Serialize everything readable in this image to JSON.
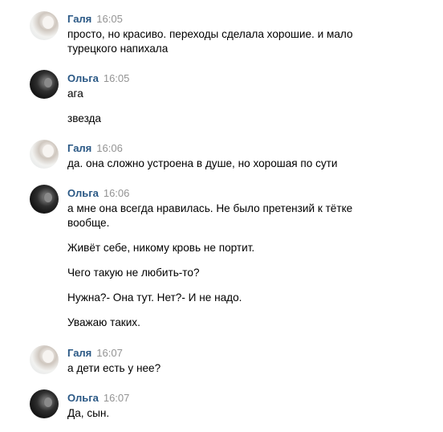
{
  "messages": [
    {
      "author": "Галя",
      "time": "16:05",
      "avatar_icon": "user-avatar-galya",
      "lines": [
        "просто, но красиво. переходы сделала хорошие. и мало",
        "турецкого напихала"
      ]
    },
    {
      "author": "Ольга",
      "time": "16:05",
      "avatar_icon": "user-avatar-olga",
      "lines": [
        "ага",
        "звезда"
      ]
    },
    {
      "author": "Галя",
      "time": "16:06",
      "avatar_icon": "user-avatar-galya",
      "lines": [
        "да. она сложно устроена в душе, но хорошая по сути"
      ]
    },
    {
      "author": "Ольга",
      "time": "16:06",
      "avatar_icon": "user-avatar-olga",
      "lines": [
        "а мне она всегда нравилась. Не было претензий к тётке",
        "вообще.",
        "Живёт себе, никому кровь не портит.",
        "Чего такую не любить-то?",
        "Нужна?- Она тут. Нет?- И не надо.",
        "Уважаю таких."
      ]
    },
    {
      "author": "Галя",
      "time": "16:07",
      "avatar_icon": "user-avatar-galya",
      "lines": [
        "а дети есть у нее?"
      ]
    },
    {
      "author": "Ольга",
      "time": "16:07",
      "avatar_icon": "user-avatar-olga",
      "lines": [
        "Да, сын."
      ]
    }
  ],
  "colors": {
    "author": "#2a5885",
    "time": "#939393",
    "text": "#000000",
    "background": "#ffffff"
  }
}
